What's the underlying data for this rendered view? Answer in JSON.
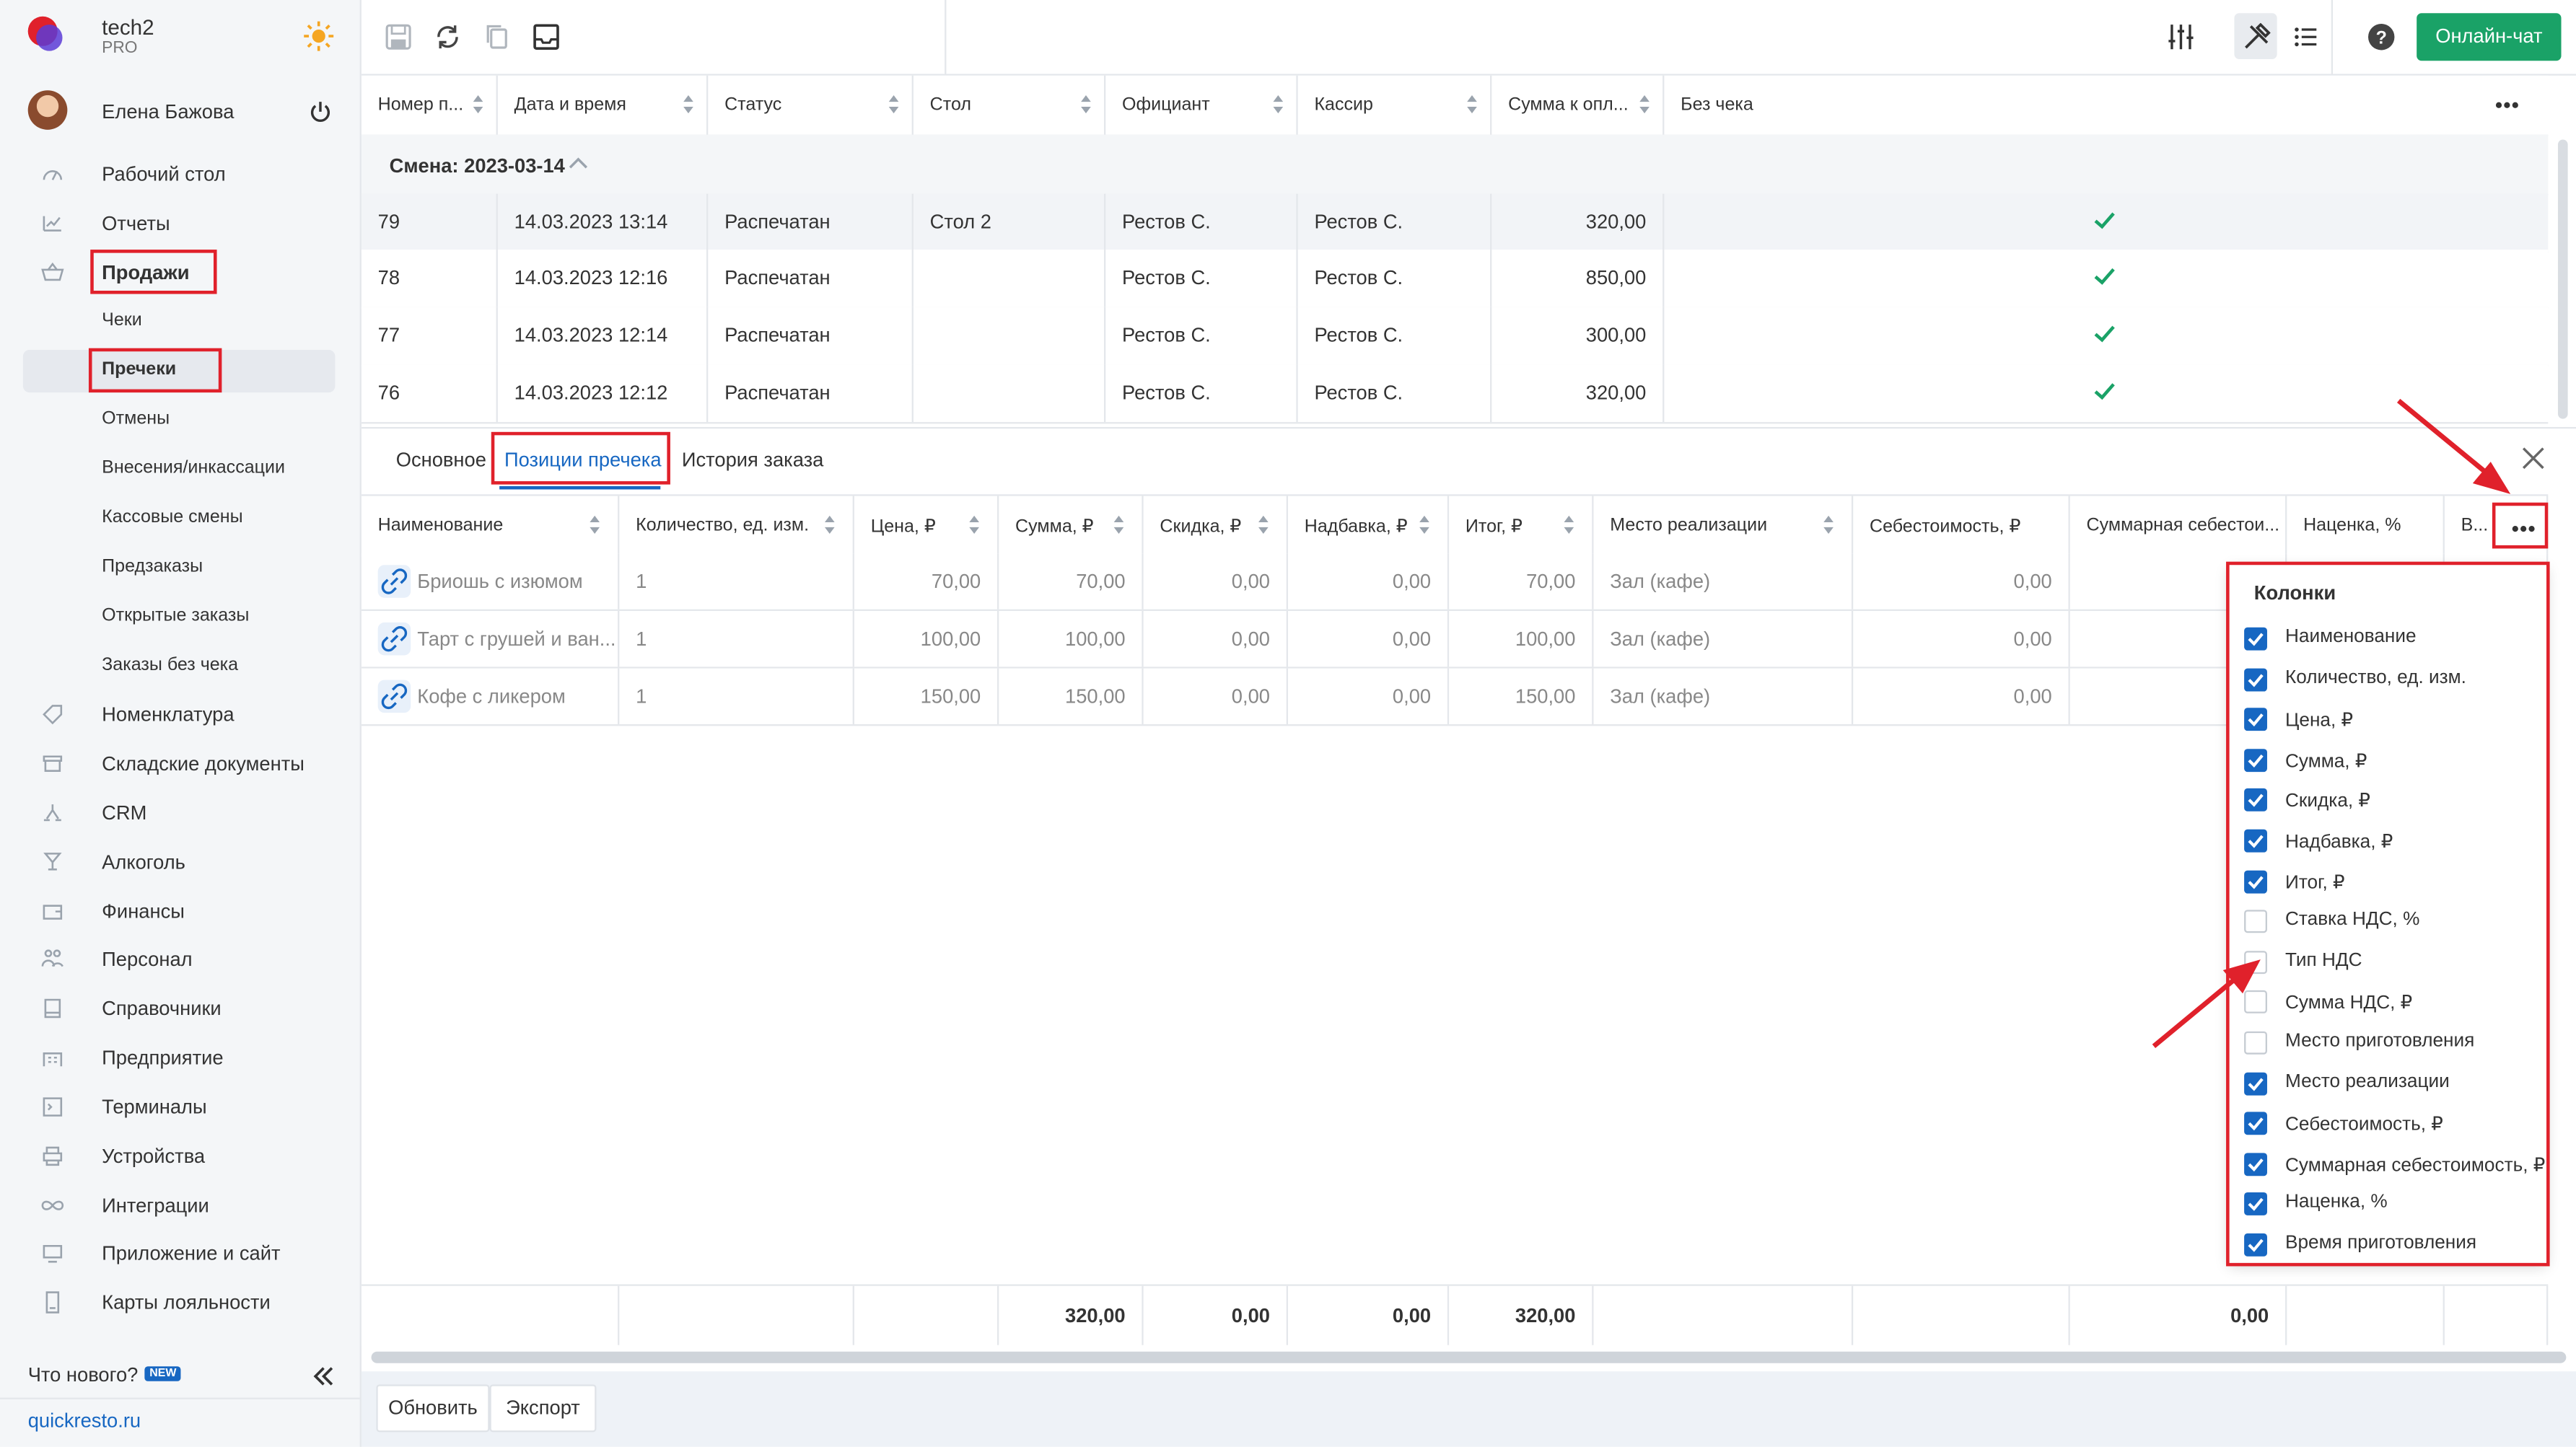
{
  "app": {
    "name": "tech2",
    "plan": "PRO",
    "site": "quickresto.ru",
    "whats_new": "Что нового?",
    "new_badge": "NEW"
  },
  "user": {
    "name": "Елена Бажова"
  },
  "sidebar": {
    "items": [
      {
        "label": "Рабочий стол",
        "icon": "dashboard-icon"
      },
      {
        "label": "Отчеты",
        "icon": "reports-icon"
      },
      {
        "label": "Продажи",
        "icon": "basket-icon"
      },
      {
        "label": "Чеки"
      },
      {
        "label": "Пречеки"
      },
      {
        "label": "Отмены"
      },
      {
        "label": "Внесения/инкассации"
      },
      {
        "label": "Кассовые смены"
      },
      {
        "label": "Предзаказы"
      },
      {
        "label": "Открытые заказы"
      },
      {
        "label": "Заказы без чека"
      },
      {
        "label": "Номенклатура",
        "icon": "tag-icon"
      },
      {
        "label": "Складские документы",
        "icon": "archive-icon"
      },
      {
        "label": "CRM",
        "icon": "crm-icon"
      },
      {
        "label": "Алкоголь",
        "icon": "glass-icon"
      },
      {
        "label": "Финансы",
        "icon": "wallet-icon"
      },
      {
        "label": "Персонал",
        "icon": "people-icon"
      },
      {
        "label": "Справочники",
        "icon": "book-icon"
      },
      {
        "label": "Предприятие",
        "icon": "building-icon"
      },
      {
        "label": "Терминалы",
        "icon": "terminal-icon"
      },
      {
        "label": "Устройства",
        "icon": "printer-icon"
      },
      {
        "label": "Интеграции",
        "icon": "infinity-icon"
      },
      {
        "label": "Приложение и сайт",
        "icon": "app-icon"
      },
      {
        "label": "Карты лояльности",
        "icon": "card-icon"
      }
    ]
  },
  "toolbar": {
    "online_chat": "Онлайн-чат"
  },
  "top_table": {
    "headers": [
      "Номер п...",
      "Дата и время",
      "Статус",
      "Стол",
      "Официант",
      "Кассир",
      "Сумма к опл...",
      "Без чека"
    ],
    "shift": "Смена: 2023-03-14",
    "rows": [
      [
        "79",
        "14.03.2023 13:14",
        "Распечатан",
        "Стол 2",
        "Рестов С.",
        "Рестов С.",
        "320,00"
      ],
      [
        "78",
        "14.03.2023 12:16",
        "Распечатан",
        "",
        "Рестов С.",
        "Рестов С.",
        "850,00"
      ],
      [
        "77",
        "14.03.2023 12:14",
        "Распечатан",
        "",
        "Рестов С.",
        "Рестов С.",
        "300,00"
      ],
      [
        "76",
        "14.03.2023 12:12",
        "Распечатан",
        "",
        "Рестов С.",
        "Рестов С.",
        "320,00"
      ]
    ]
  },
  "tabs": [
    "Основное",
    "Позиции пречека",
    "История заказа"
  ],
  "positions": {
    "headers": [
      "Наименование",
      "Количество, ед. изм.",
      "Цена, ₽",
      "Сумма, ₽",
      "Скидка, ₽",
      "Надбавка, ₽",
      "Итог, ₽",
      "Место реализации",
      "Себестоимость, ₽",
      "Суммарная себестои...",
      "Наценка, %",
      "В..."
    ],
    "rows": [
      [
        "Бриошь с изюмом",
        "1",
        "70,00",
        "70,00",
        "0,00",
        "0,00",
        "70,00",
        "Зал (кафе)",
        "0,00"
      ],
      [
        "Тарт с грушей и ван...",
        "1",
        "100,00",
        "100,00",
        "0,00",
        "0,00",
        "100,00",
        "Зал (кафе)",
        "0,00"
      ],
      [
        "Кофе с ликером",
        "1",
        "150,00",
        "150,00",
        "0,00",
        "0,00",
        "150,00",
        "Зал (кафе)",
        "0,00"
      ]
    ],
    "totals": {
      "sum": "320,00",
      "discount": "0,00",
      "markup": "0,00",
      "total": "320,00",
      "cost_sum": "0,00"
    }
  },
  "columns_popup": {
    "title": "Колонки",
    "items": [
      {
        "label": "Наименование",
        "checked": true
      },
      {
        "label": "Количество, ед. изм.",
        "checked": true
      },
      {
        "label": "Цена, ₽",
        "checked": true
      },
      {
        "label": "Сумма, ₽",
        "checked": true
      },
      {
        "label": "Скидка, ₽",
        "checked": true
      },
      {
        "label": "Надбавка, ₽",
        "checked": true
      },
      {
        "label": "Итог, ₽",
        "checked": true
      },
      {
        "label": "Ставка НДС, %",
        "checked": false
      },
      {
        "label": "Тип НДС",
        "checked": false
      },
      {
        "label": "Сумма НДС, ₽",
        "checked": false
      },
      {
        "label": "Место приготовления",
        "checked": false
      },
      {
        "label": "Место реализации",
        "checked": true
      },
      {
        "label": "Себестоимость, ₽",
        "checked": true
      },
      {
        "label": "Суммарная себестоимость, ₽",
        "checked": true
      },
      {
        "label": "Наценка, %",
        "checked": true
      },
      {
        "label": "Время приготовления",
        "checked": true
      }
    ]
  },
  "bottom": {
    "refresh": "Обновить",
    "export": "Экспорт"
  },
  "colors": {
    "accent": "#1767c2",
    "chat_button": "#1aa267",
    "highlight": "#e0212b",
    "check": "#1aa267"
  }
}
